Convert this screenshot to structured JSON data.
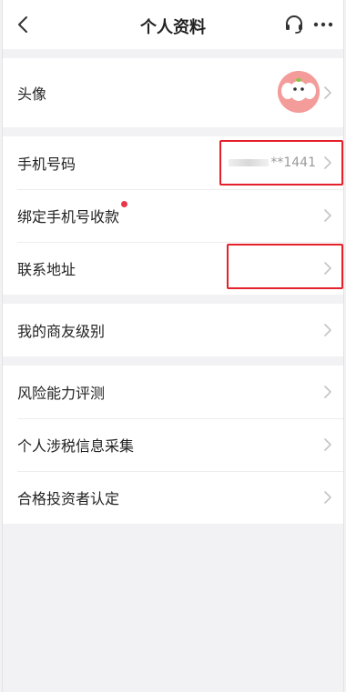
{
  "header": {
    "title": "个人资料",
    "back_icon": "back-icon",
    "support_icon": "headset-icon",
    "more_icon": "more-icon"
  },
  "sections": [
    {
      "rows": [
        {
          "label": "头像",
          "type": "avatar"
        }
      ]
    },
    {
      "rows": [
        {
          "label": "手机号码",
          "value": "**1441",
          "highlighted": true
        },
        {
          "label": "绑定手机号收款",
          "badge": "red-dot"
        },
        {
          "label": "联系地址",
          "value": "",
          "highlighted": true
        }
      ]
    },
    {
      "rows": [
        {
          "label": "我的商友级别"
        }
      ]
    },
    {
      "rows": [
        {
          "label": "风险能力评测"
        },
        {
          "label": "个人涉税信息采集"
        },
        {
          "label": "合格投资者认定"
        }
      ]
    }
  ],
  "colors": {
    "background": "#f2f2f4",
    "highlight_box": "#e5202a",
    "badge": "#e8364b",
    "avatar_bg": "#f39c9a"
  }
}
